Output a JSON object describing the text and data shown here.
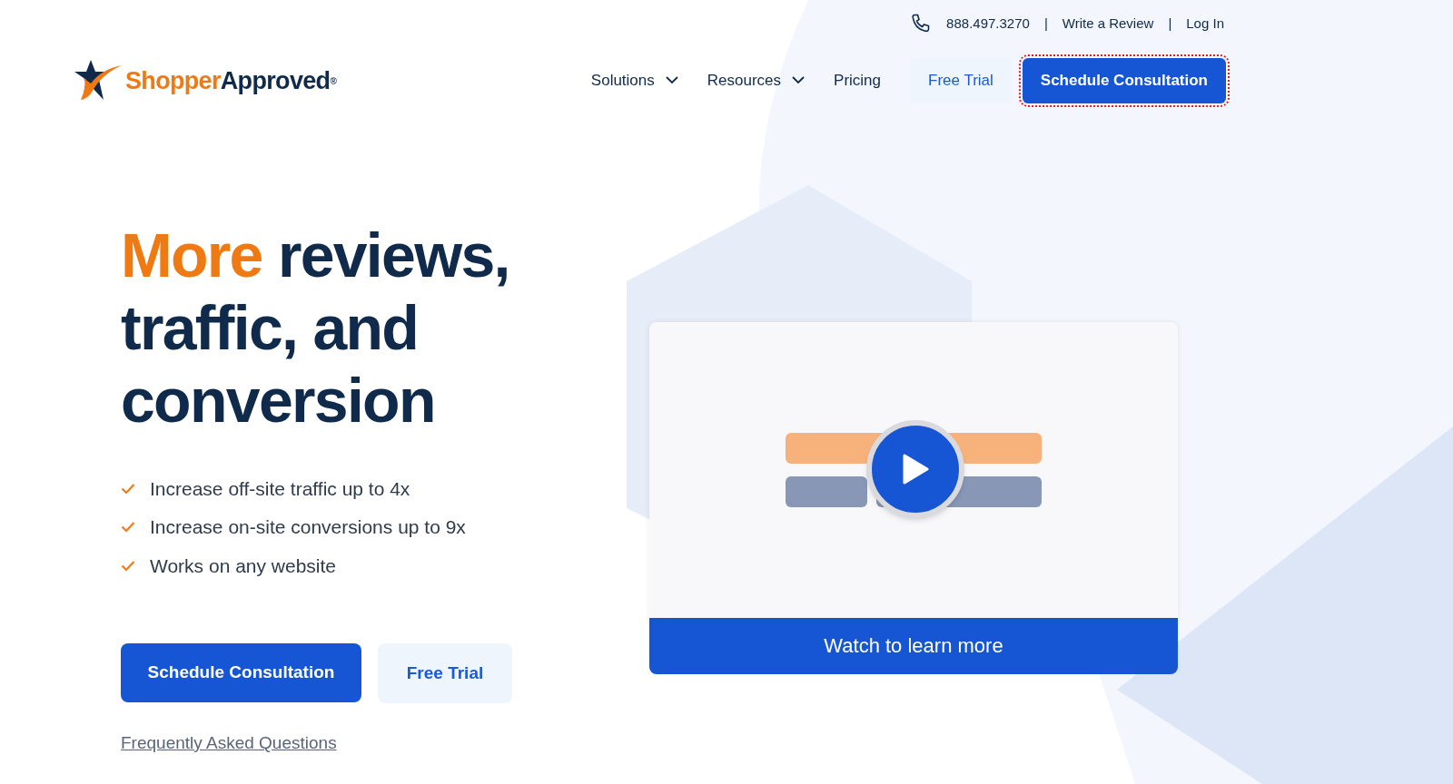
{
  "top_bar": {
    "phone": "888.497.3270",
    "separator_1": "|",
    "write_review": "Write a Review",
    "separator_2": "|",
    "login": "Log In"
  },
  "logo": {
    "part_1": "Shopper",
    "part_2": "Approved",
    "mark": "®"
  },
  "nav": [
    {
      "label": "Solutions",
      "kind": "dropdown"
    },
    {
      "label": "Resources",
      "kind": "dropdown"
    },
    {
      "label": "Pricing",
      "kind": "link"
    },
    {
      "label": "Free Trial",
      "kind": "secondary"
    },
    {
      "label": "Schedule Consultation",
      "kind": "primary",
      "focused": true
    }
  ],
  "hero": {
    "headline_accent": "More",
    "headline_rest": "reviews, traffic, and conversion",
    "benefits": [
      "Increase off-site traffic up to 4x",
      "Increase on-site conversions up to 9x",
      "Works on any website"
    ],
    "buttons": [
      {
        "label": "Schedule Consultation",
        "kind": "primary"
      },
      {
        "label": "Free Trial",
        "kind": "secondary"
      }
    ],
    "faq_link": "Frequently Asked Questions"
  },
  "video": {
    "kind": "picture",
    "cta": "Watch to learn more"
  }
}
